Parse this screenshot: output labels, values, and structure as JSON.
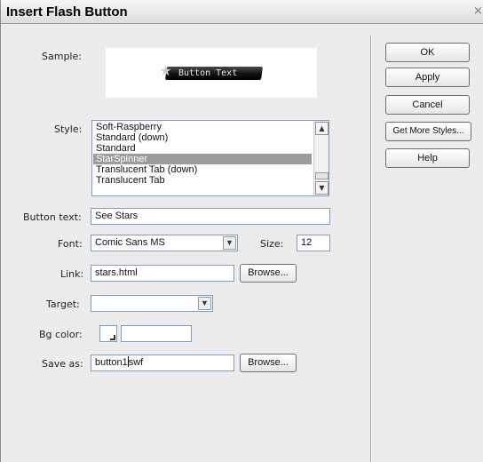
{
  "window": {
    "title": "Insert Flash Button",
    "close_glyph": "×"
  },
  "sample": {
    "label": "Sample:",
    "button_text": "Button Text",
    "icon": "star-icon"
  },
  "style": {
    "label": "Style:",
    "items": [
      "Soft-Raspberry",
      "Standard (down)",
      "Standard",
      "StarSpinner",
      "Translucent Tab (down)",
      "Translucent Tab"
    ],
    "selected": "StarSpinner"
  },
  "button_text": {
    "label": "Button text:",
    "value": "See Stars"
  },
  "font": {
    "label": "Font:",
    "value": "Comic Sans MS",
    "size_label": "Size:",
    "size_value": "12"
  },
  "link": {
    "label": "Link:",
    "value": "stars.html",
    "browse_label": "Browse..."
  },
  "target": {
    "label": "Target:",
    "value": ""
  },
  "bg_color": {
    "label": "Bg color:",
    "value": ""
  },
  "save_as": {
    "label": "Save as:",
    "value_before_caret": "button1",
    "value_after_caret": "swf",
    "browse_label": "Browse..."
  },
  "actions": {
    "ok": "OK",
    "apply": "Apply",
    "cancel": "Cancel",
    "get_more": "Get More Styles...",
    "help": "Help"
  },
  "colors": {
    "selection": "#9c9c9c",
    "dialog_bg": "#ececec",
    "field_border": "#7f9db9"
  }
}
